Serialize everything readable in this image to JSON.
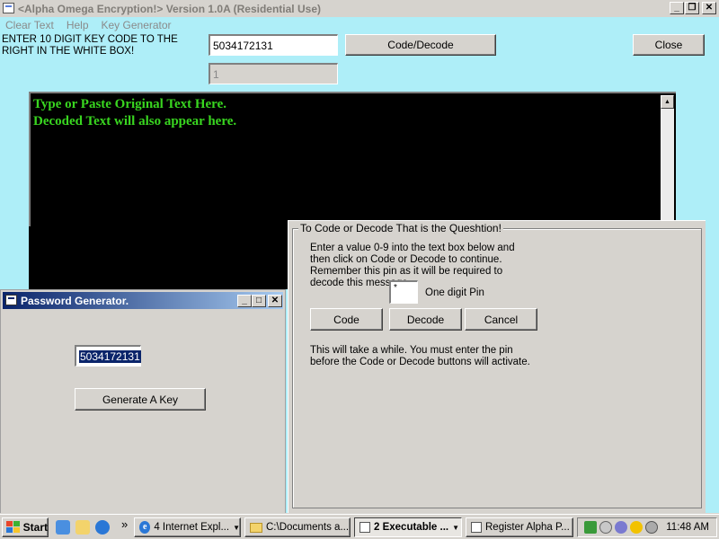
{
  "main_window": {
    "title": "<Alpha Omega Encryption!> Version 1.0A (Residential Use)",
    "menu": [
      "Clear Text",
      "Help",
      "Key Generator"
    ],
    "instruction": "ENTER 10 DIGIT KEY CODE TO THE RIGHT IN THE WHITE BOX!",
    "key_input_value": "5034172131",
    "pin_display_value": "1",
    "code_decode_button": "Code/Decode",
    "close_button": "Close",
    "text_area_lines": [
      "Type or Paste Original Text Here.",
      "Decoded Text will also appear here."
    ]
  },
  "code_decode_frame": {
    "title": "To Code or Decode That is the Queshtion!",
    "instructions": "Enter a value 0-9 into the text box below and then click on Code or Decode to continue. Remember this pin as it will be required to decode this message.",
    "pin_input_value": "*",
    "pin_label": "One digit Pin",
    "code_button": "Code",
    "decode_button": "Decode",
    "cancel_button": "Cancel",
    "note": "This will take a while. You must enter the pin before the Code or Decode buttons will activate."
  },
  "password_generator": {
    "title": "Password Generator.",
    "generated_key": "5034172131",
    "generate_button": "Generate A Key"
  },
  "taskbar": {
    "start_label": "Start",
    "chevron": "»",
    "tasks": [
      {
        "label": "4 Internet Expl...",
        "icon": "ie-icon",
        "active": false
      },
      {
        "label": "C:\\Documents a...",
        "icon": "folder-icon",
        "active": false
      },
      {
        "label": "2 Executable ...",
        "icon": "app-icon",
        "active": true
      },
      {
        "label": "Register Alpha P...",
        "icon": "document-icon",
        "active": false
      }
    ],
    "clock": "11:48 AM"
  },
  "colors": {
    "desktop_background": "#aeeef8",
    "text_area_bg": "#000000",
    "text_area_fg": "#39d620",
    "active_title_start": "#0a246a",
    "active_title_end": "#a6caf0"
  }
}
